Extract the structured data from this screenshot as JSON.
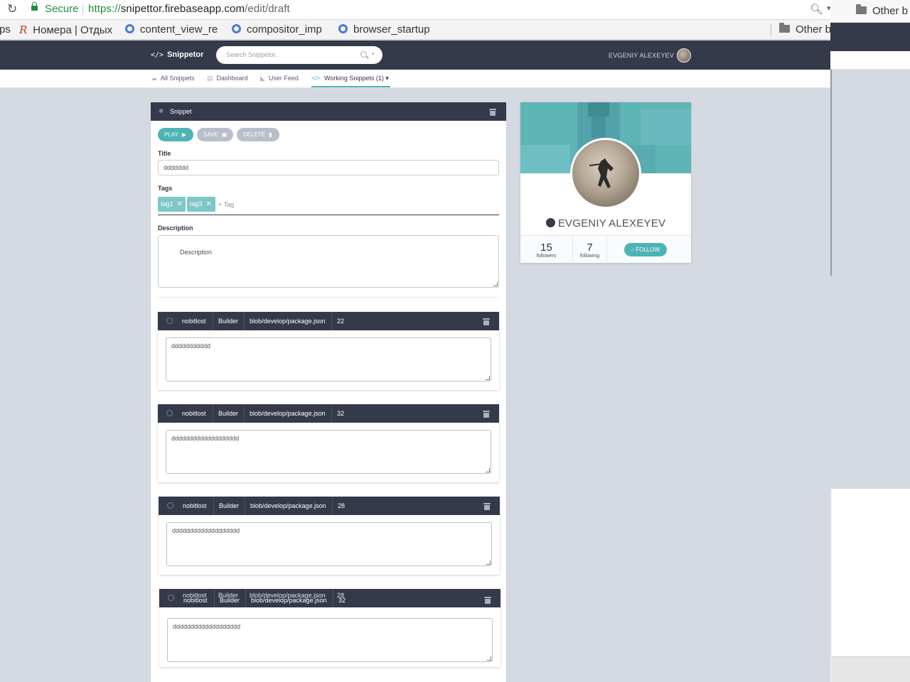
{
  "browser": {
    "secure_label": "Secure",
    "url_protocol": "https://",
    "url_host": "snipettor.firebaseapp.com",
    "url_path": "/edit/draft",
    "bookmarks": [
      {
        "label": "ps",
        "icon": "none"
      },
      {
        "label": "Номера | Отдых",
        "icon": "r-logo-icon"
      },
      {
        "label": "content_view_re",
        "icon": "chromium-icon"
      },
      {
        "label": "compositor_imp",
        "icon": "chromium-icon"
      },
      {
        "label": "browser_startup",
        "icon": "chromium-icon"
      }
    ],
    "other_bookmarks_label": "Other b",
    "second_window_bookmarks_label": "Other b"
  },
  "app": {
    "logo_text": "Snippetor",
    "search_placeholder": "Search Snippetor..",
    "user_name": "EVGENIY ALEXEYEV",
    "tabs": [
      {
        "label": "All Snippets",
        "active": false
      },
      {
        "label": "Dashboard",
        "active": false
      },
      {
        "label": "User Feed",
        "active": false
      },
      {
        "label": "Working Snippets (1)",
        "active": true
      }
    ],
    "accent_color": "#4db3b5",
    "header_color": "#353a4a"
  },
  "snippet": {
    "header_title": "Snippet",
    "buttons": {
      "play": "PLAY",
      "save": "SAVE",
      "delete": "DELETE"
    },
    "title_label": "Title",
    "title_value": "ddddddd",
    "tags_label": "Tags",
    "tags": [
      "tag1",
      "tag3"
    ],
    "tag_add_label": "+ Tag",
    "description_label": "Description",
    "description_placeholder": "Description"
  },
  "files": [
    {
      "user": "nobitlost",
      "repo": "Builder",
      "path": "blob/develop/package.json",
      "line": "22",
      "content": "ddddddddddd"
    },
    {
      "user": "nobitlost",
      "repo": "Builder",
      "path": "blob/develop/package.json",
      "line": "32",
      "content": "ddddddddddddddddddd"
    },
    {
      "user": "nobitlost",
      "repo": "Builder",
      "path": "blob/develop/package.json",
      "line": "28",
      "content": "ddddddddddddddddddd"
    },
    {
      "user": "nobitlost",
      "repo": "Builder",
      "path": "blob/develop/package.json",
      "line": "32",
      "content": "ddddddddddddddddddd",
      "ghost_user": "nobitlost",
      "ghost_repo": "Builder",
      "ghost_path": "blob/develop/package.json",
      "ghost_line": "28"
    }
  ],
  "profile": {
    "name": "EVGENIY ALEXEYEV",
    "followers_count": "15",
    "followers_label": "followers",
    "following_count": "7",
    "following_label": "following",
    "follow_button": "FOLLOW"
  }
}
